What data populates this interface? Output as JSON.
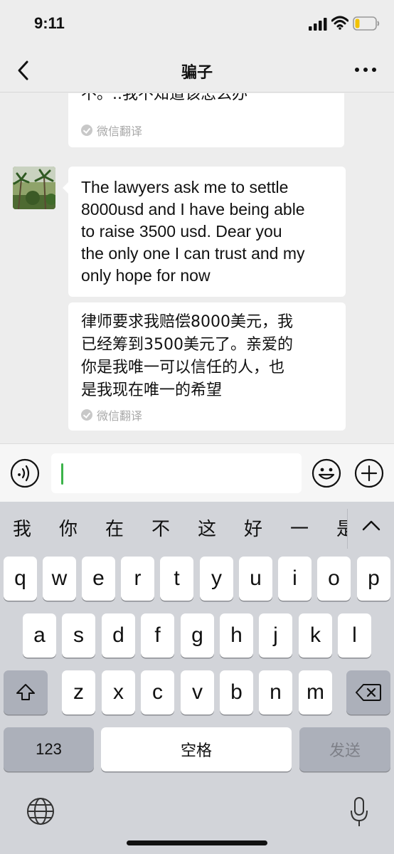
{
  "status": {
    "time": "9:11"
  },
  "nav": {
    "title": "骗子"
  },
  "messages": {
    "prev_cn": "不。..我不知道该怎么办",
    "prev_translation_label": "微信翻译",
    "en_text": "The lawyers ask me to settle\n8000usd and I have being able\n to raise 3500 usd. Dear you\nthe only one I can trust and my\nonly hope for now",
    "cn_text": "律师要求我赔偿8000美元，我\n已经筹到3500美元了。亲爱的\n你是我唯一可以信任的人，也\n是我现在唯一的希望",
    "translation_label": "微信翻译"
  },
  "input": {
    "value": ""
  },
  "candidates": [
    "我",
    "你",
    "在",
    "不",
    "这",
    "好",
    "一",
    "是"
  ],
  "keys": {
    "row1": [
      "q",
      "w",
      "e",
      "r",
      "t",
      "y",
      "u",
      "i",
      "o",
      "p"
    ],
    "row2": [
      "a",
      "s",
      "d",
      "f",
      "g",
      "h",
      "j",
      "k",
      "l"
    ],
    "row3": [
      "z",
      "x",
      "c",
      "v",
      "b",
      "n",
      "m"
    ],
    "numbers_label": "123",
    "space_label": "空格",
    "send_label": "发送"
  },
  "icons": {
    "signal": "signal-icon",
    "wifi": "wifi-icon",
    "battery": "battery-icon",
    "back": "back-icon",
    "more": "more-icon",
    "voice": "voice-icon",
    "emoji": "emoji-icon",
    "plus": "plus-icon",
    "globe": "globe-icon",
    "mic": "mic-icon",
    "shift": "shift-icon",
    "delete": "delete-icon"
  },
  "colors": {
    "accent": "#3cb34a",
    "battery_low": "#f2c200"
  }
}
